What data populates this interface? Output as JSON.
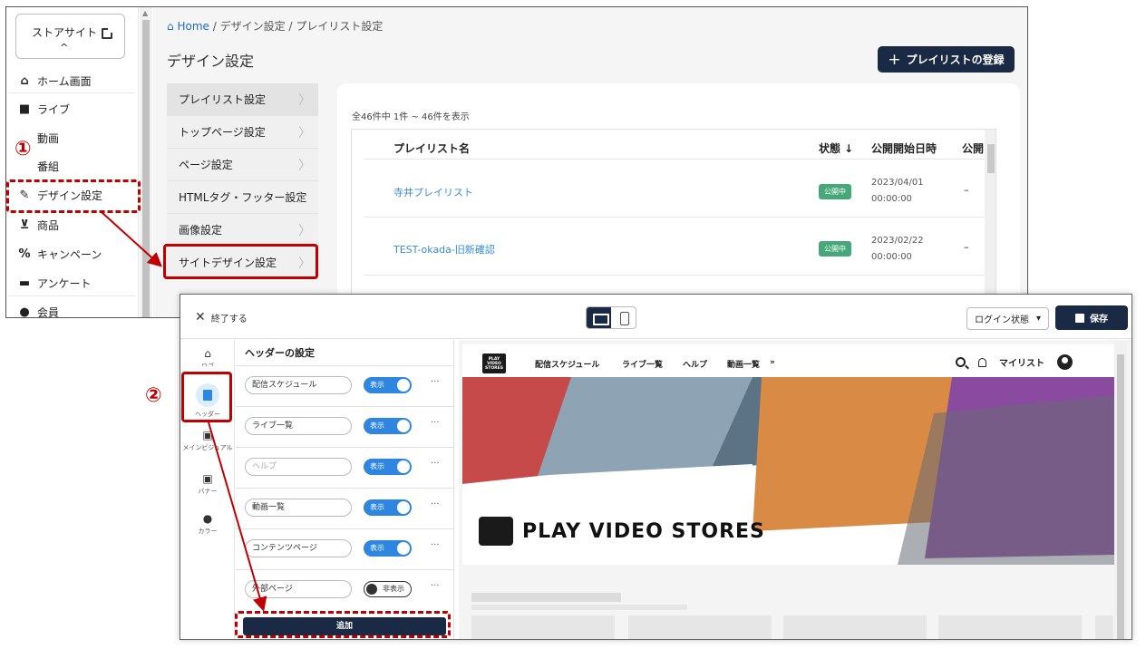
{
  "back": {
    "store_button": "ストアサイト",
    "store_chevron": "^",
    "sidebar": [
      {
        "label": "ホーム画面",
        "icon": "home-icon"
      },
      {
        "label": "ライブ",
        "icon": "video-camera-icon"
      },
      {
        "label": "動画",
        "icon": "film-icon"
      },
      {
        "label": "番組",
        "icon": "program-icon"
      },
      {
        "label": "デザイン設定",
        "icon": "brush-icon"
      },
      {
        "label": "商品",
        "icon": "cart-icon"
      },
      {
        "label": "キャンペーン",
        "icon": "percent-icon"
      },
      {
        "label": "アンケート",
        "icon": "survey-icon"
      },
      {
        "label": "会員",
        "icon": "members-icon"
      }
    ],
    "breadcrumb": {
      "home": "Home",
      "sep1": "/",
      "item1": "デザイン設定",
      "sep2": "/",
      "item2": "プレイリスト設定"
    },
    "page_title": "デザイン設定",
    "add_playlist_button": "プレイリストの登録",
    "submenu": [
      "プレイリスト設定",
      "トップページ設定",
      "ページ設定",
      "HTMLタグ・フッター設定",
      "画像設定",
      "サイトデザイン設定"
    ],
    "count_text": "全46件中 1件 ~ 46件を表示",
    "table": {
      "headers": [
        "プレイリスト名",
        "状態 ↓",
        "公開開始日時",
        "公開"
      ],
      "rows": [
        {
          "name": "寺井プレイリスト",
          "status": "公開中",
          "date": "2023/04/01",
          "time": "00:00:00",
          "end": "–"
        },
        {
          "name": "TEST-okada-旧新確認",
          "status": "公開中",
          "date": "2023/02/22",
          "time": "00:00:00",
          "end": "–"
        }
      ]
    }
  },
  "annotations": {
    "step1": "①",
    "step2": "②"
  },
  "front": {
    "close_label": "終了する",
    "login_state": "ログイン状態",
    "login_caret": "▾",
    "save_label": "保存",
    "rail": [
      {
        "label": "ロゴ",
        "icon": "home-icon"
      },
      {
        "label": "ヘッダー",
        "icon": "header-icon"
      },
      {
        "label": "メインビジュアル",
        "icon": "image-icon"
      },
      {
        "label": "バナー",
        "icon": "banner-icon"
      },
      {
        "label": "カラー",
        "icon": "palette-icon"
      }
    ],
    "panel_title": "ヘッダーの設定",
    "header_items": [
      {
        "label": "配信スケジュール",
        "toggle": "表示",
        "on": true,
        "placeholder": false
      },
      {
        "label": "ライブ一覧",
        "toggle": "表示",
        "on": true,
        "placeholder": false
      },
      {
        "label": "ヘルプ",
        "toggle": "表示",
        "on": true,
        "placeholder": true
      },
      {
        "label": "動画一覧",
        "toggle": "表示",
        "on": true,
        "placeholder": false
      },
      {
        "label": "コンテンツページ",
        "toggle": "表示",
        "on": true,
        "placeholder": false
      },
      {
        "label": "外部ページ",
        "toggle": "非表示",
        "on": false,
        "placeholder": false
      }
    ],
    "more": "···",
    "add_label": "追加",
    "preview": {
      "logo_text": "PLAY VIDEO STORES",
      "nav": [
        "配信スケジュール",
        "ライブ一覧",
        "ヘルプ",
        "動画一覧",
        "»"
      ],
      "my_list": "マイリスト",
      "hero_brand": "PLAY VIDEO STORES"
    }
  }
}
